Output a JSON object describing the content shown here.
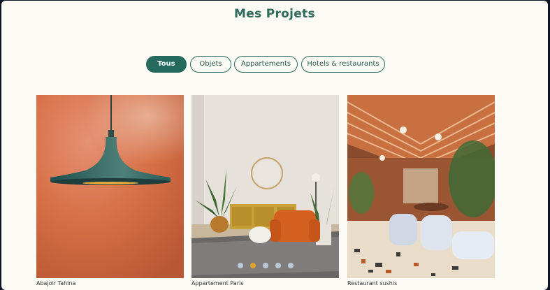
{
  "page": {
    "title": "Mes Projets"
  },
  "filters": [
    {
      "label": "Tous",
      "active": true
    },
    {
      "label": "Objets",
      "active": false
    },
    {
      "label": "Appartements",
      "active": false
    },
    {
      "label": "Hotels & restaurants",
      "active": false
    }
  ],
  "projects": [
    {
      "caption": "Abajoir Tahina"
    },
    {
      "caption": "Appartement Paris"
    },
    {
      "caption": "Restaurant sushis"
    }
  ],
  "carousel": {
    "total": 5,
    "active_index": 1
  }
}
